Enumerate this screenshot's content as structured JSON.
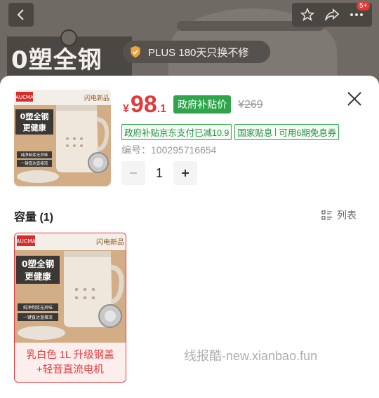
{
  "background": {
    "banner_text": "0塑全钢",
    "badge_count": "5+",
    "plus_banner": "PLUS 180天只换不修"
  },
  "product": {
    "price_currency": "¥",
    "price_integer": "98",
    "price_decimal": ".1",
    "subsidy_tag": "政府补贴价",
    "original_price": "¥269",
    "promos": [
      {
        "text": "政府补贴京东支付已减10.9"
      },
      {
        "left": "国家贴息",
        "right": "可用6期免息券"
      }
    ],
    "sku_code": "编号：100295716654",
    "quantity": "1"
  },
  "thumbnail": {
    "brand": "AUCMA",
    "tag": "闪电新品",
    "headline_1": "0塑全钢",
    "headline_2": "更健康",
    "features": [
      "纯净制浆无异味",
      "一键直达直接流"
    ]
  },
  "capacity": {
    "header": "容量 (1)",
    "list_label": "列表",
    "options": [
      {
        "label": "乳白色 1L 升级钢盖 +轻音直流电机",
        "selected": true
      }
    ]
  },
  "watermark": "线报酷-new.xianbao.fun",
  "colors": {
    "accent_red": "#e4393c",
    "subsidy_green": "#2ea54a"
  }
}
